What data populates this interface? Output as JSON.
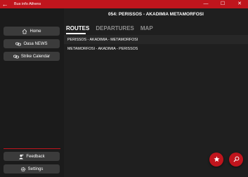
{
  "window": {
    "title": "Bus info Athens",
    "back_icon": "arrow-left-icon",
    "minimize_glyph": "—",
    "maximize_glyph": "☐",
    "close_glyph": "✕"
  },
  "sidebar": {
    "items": [
      {
        "label": "Home",
        "icon": "home-icon"
      },
      {
        "label": "Oasa NEWS",
        "icon": "link-icon"
      },
      {
        "label": "Strike Calendar",
        "icon": "link-icon"
      }
    ],
    "bottom_items": [
      {
        "label": "Feedback",
        "icon": "person-add-icon"
      },
      {
        "label": "Settings",
        "icon": "gear-icon"
      }
    ]
  },
  "main": {
    "title": "054: PERISSOS - AKADIMIA METAMORFOSI",
    "tabs": [
      {
        "label": "ROUTES",
        "active": true
      },
      {
        "label": "DEPARTURES",
        "active": false
      },
      {
        "label": "MAP",
        "active": false
      }
    ],
    "routes": [
      {
        "label": "PERISSOS - AKADIMIA - METAMORFOSI"
      },
      {
        "label": "METAMORFOSI - AKADIMIA - PERISSOS"
      }
    ]
  },
  "fabs": {
    "favorite_icon": "star-icon",
    "search_icon": "search-icon"
  },
  "colors": {
    "accent": "#c0151d",
    "background": "#1f1f1f",
    "button": "#3b3b3b",
    "inactive_tab": "#8e8e8e"
  }
}
